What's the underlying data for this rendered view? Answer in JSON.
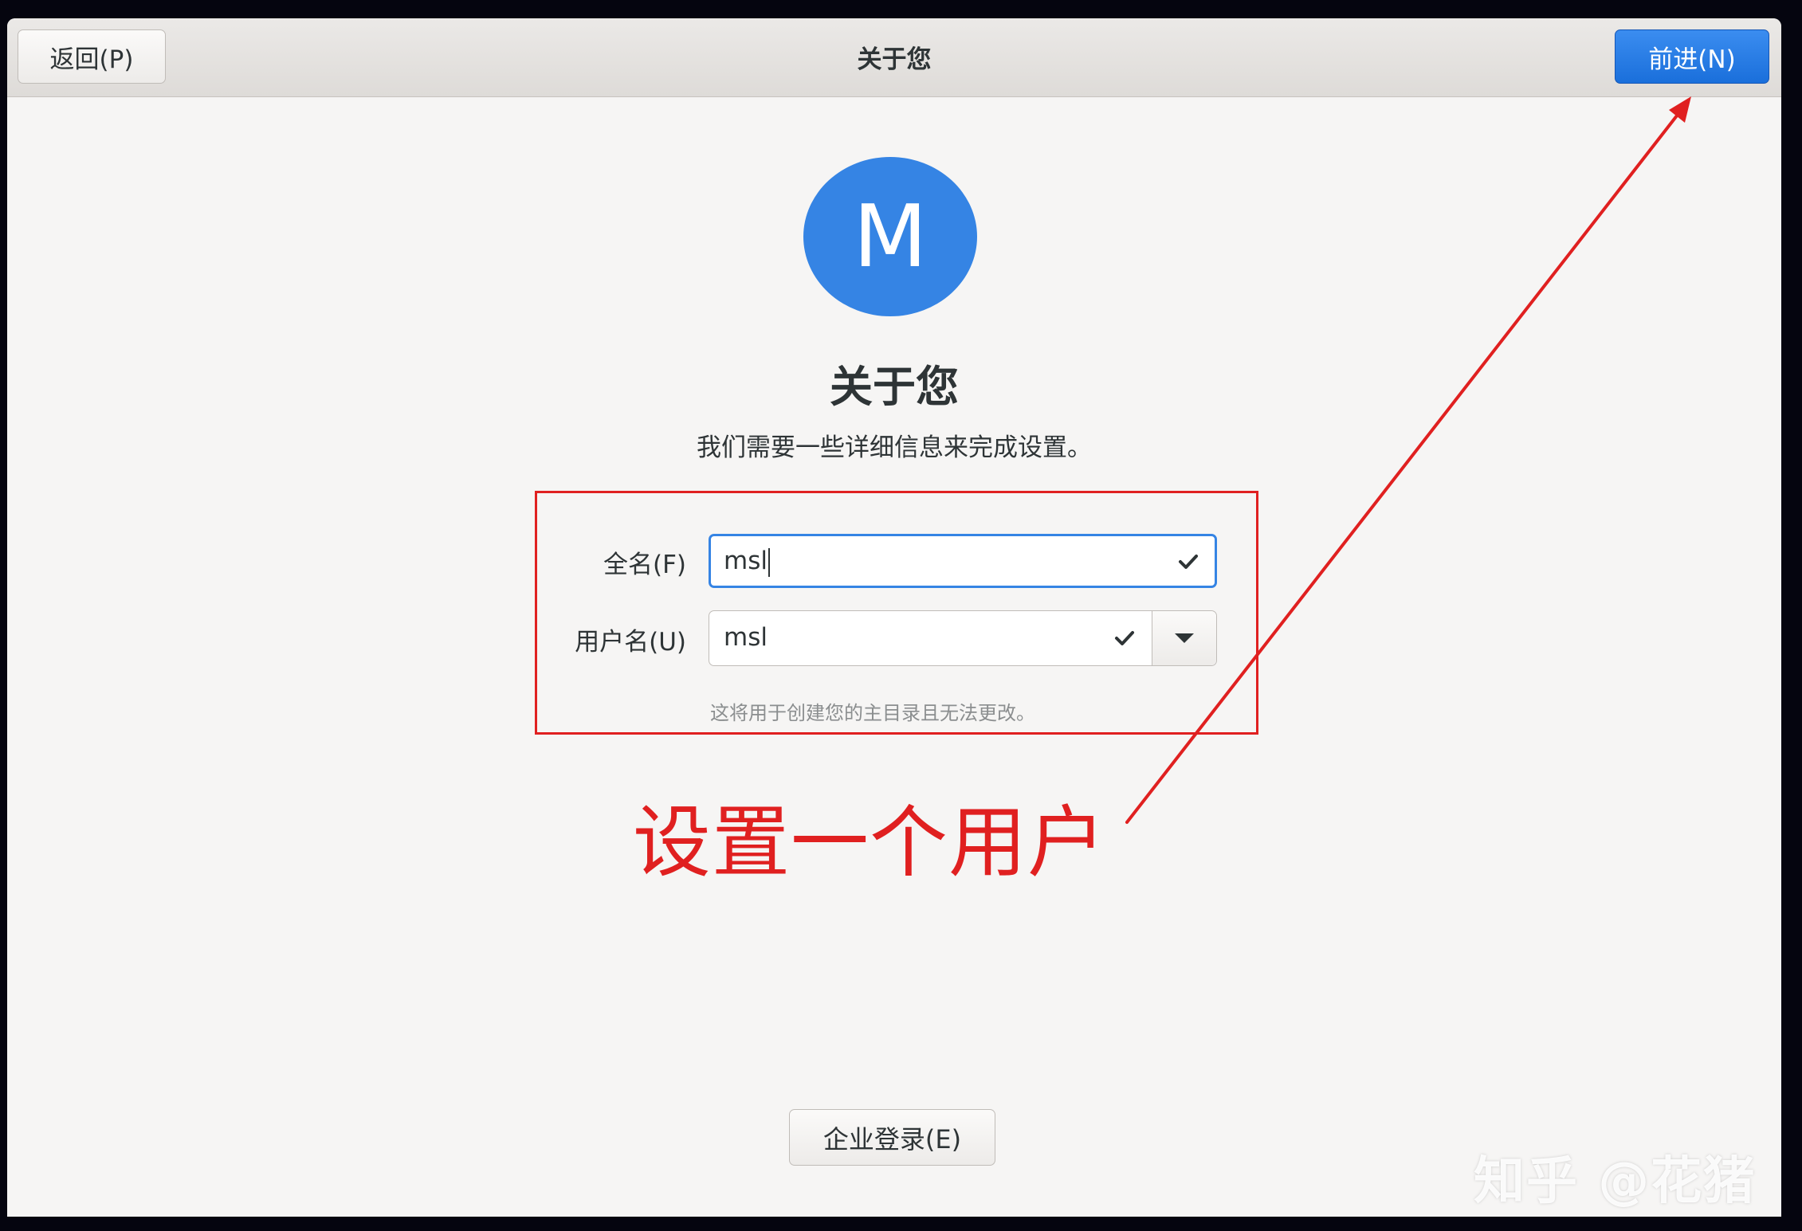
{
  "header": {
    "back_label": "返回(P)",
    "title": "关于您",
    "forward_label": "前进(N)"
  },
  "avatar": {
    "initial": "M",
    "color": "#3584e4"
  },
  "main": {
    "title": "关于您",
    "subtitle": "我们需要一些详细信息来完成设置。"
  },
  "form": {
    "fullname_label": "全名(F)",
    "fullname_value": "msl",
    "username_label": "用户名(U)",
    "username_value": "msl",
    "hint": "这将用于创建您的主目录且无法更改。"
  },
  "annotation": {
    "text": "设置一个用户",
    "color": "#e02020"
  },
  "footer": {
    "enterprise_label": "企业登录(E)"
  },
  "watermark": "知乎 @花猪",
  "colors": {
    "accent": "#3584e4",
    "annotation": "#e02020"
  }
}
